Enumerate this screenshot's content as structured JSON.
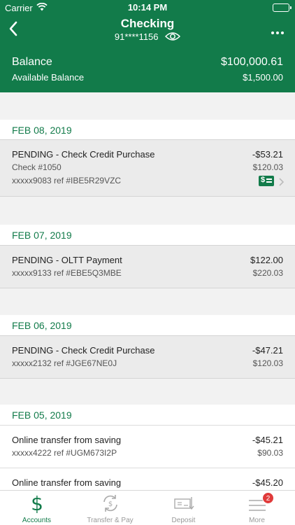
{
  "status_bar": {
    "carrier": "Carrier",
    "time": "10:14 PM"
  },
  "header": {
    "title": "Checking",
    "account_masked": "91****1156",
    "balance_label": "Balance",
    "balance_value": "$100,000.61",
    "available_label": "Available Balance",
    "available_value": "$1,500.00"
  },
  "groups": [
    {
      "date": "FEB 08, 2019",
      "transactions": [
        {
          "desc": "PENDING - Check Credit Purchase",
          "amount": "-$53.21",
          "line2": "Check #1050",
          "balance": "$120.03",
          "ref": "xxxxx9083 ref #IBE5R29VZC"
        }
      ]
    },
    {
      "date": "FEB 07, 2019",
      "transactions": [
        {
          "desc": "PENDING - OLTT Payment",
          "amount": "$122.00",
          "line2": "xxxxx9133 ref #EBE5Q3MBE",
          "balance": "$220.03"
        }
      ]
    },
    {
      "date": "FEB 06, 2019",
      "transactions": [
        {
          "desc": "PENDING - Check Credit Purchase",
          "amount": "-$47.21",
          "line2": "xxxxx2132 ref #JGE67NE0J",
          "balance": "$120.03"
        }
      ]
    },
    {
      "date": "FEB 05, 2019",
      "transactions": [
        {
          "desc": "Online transfer from saving",
          "amount": "-$45.21",
          "line2": "xxxxx4222 ref #UGM673I2P",
          "balance": "$90.03"
        },
        {
          "desc": "Online transfer from saving",
          "amount": "-$45.20"
        }
      ]
    }
  ],
  "tabs": [
    {
      "label": "Accounts",
      "icon": "dollar-icon",
      "active": true
    },
    {
      "label": "Transfer & Pay",
      "icon": "transfer-icon",
      "active": false
    },
    {
      "label": "Deposit",
      "icon": "deposit-check-icon",
      "active": false
    },
    {
      "label": "More",
      "icon": "menu-icon",
      "active": false,
      "badge": "2"
    }
  ],
  "colors": {
    "brand_green": "#127b4a",
    "badge_red": "#e03b3b",
    "pending_row_bg": "#ebebeb"
  }
}
